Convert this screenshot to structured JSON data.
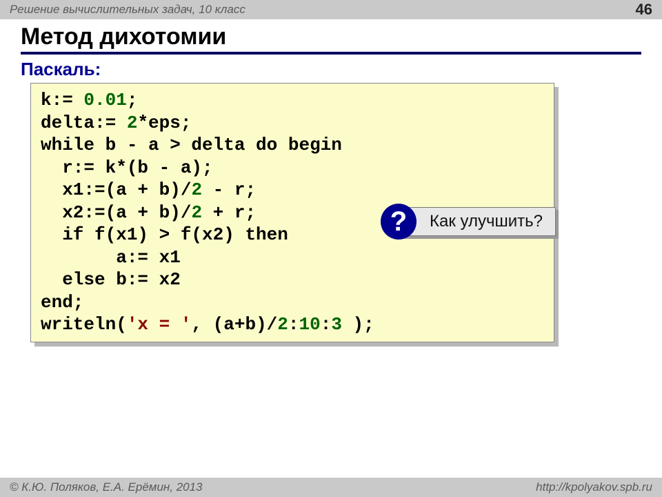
{
  "header": {
    "course": "Решение вычислительных задач, 10 класс",
    "page": "46"
  },
  "title": "Метод дихотомии",
  "subtitle": "Паскаль:",
  "code": {
    "l1a": "k:= ",
    "l1n": "0.01",
    "l1b": ";",
    "l2a": "delta:= ",
    "l2n": "2",
    "l2b": "*eps;",
    "l3": "while b - a > delta do begin",
    "l4": "  r:= k*(b - a);",
    "l5a": "  x1:=(a + b)/",
    "l5n": "2",
    "l5b": " - r;",
    "l6a": "  x2:=(a + b)/",
    "l6n": "2",
    "l6b": " + r;",
    "l7": "  if f(x1) > f(x2) then",
    "l8": "       a:= x1",
    "l9": "  else b:= x2",
    "l10": "end;",
    "l11a": "writeln(",
    "l11s": "'x = '",
    "l11b": ", (a+b)/",
    "l11n1": "2",
    "l11c": ":",
    "l11n2": "10",
    "l11d": ":",
    "l11n3": "3",
    "l11e": " );"
  },
  "callout": {
    "icon": "?",
    "text": "Как улучшить?"
  },
  "footer": {
    "left": "© К.Ю. Поляков, Е.А. Ерёмин, 2013",
    "right": "http://kpolyakov.spb.ru"
  }
}
